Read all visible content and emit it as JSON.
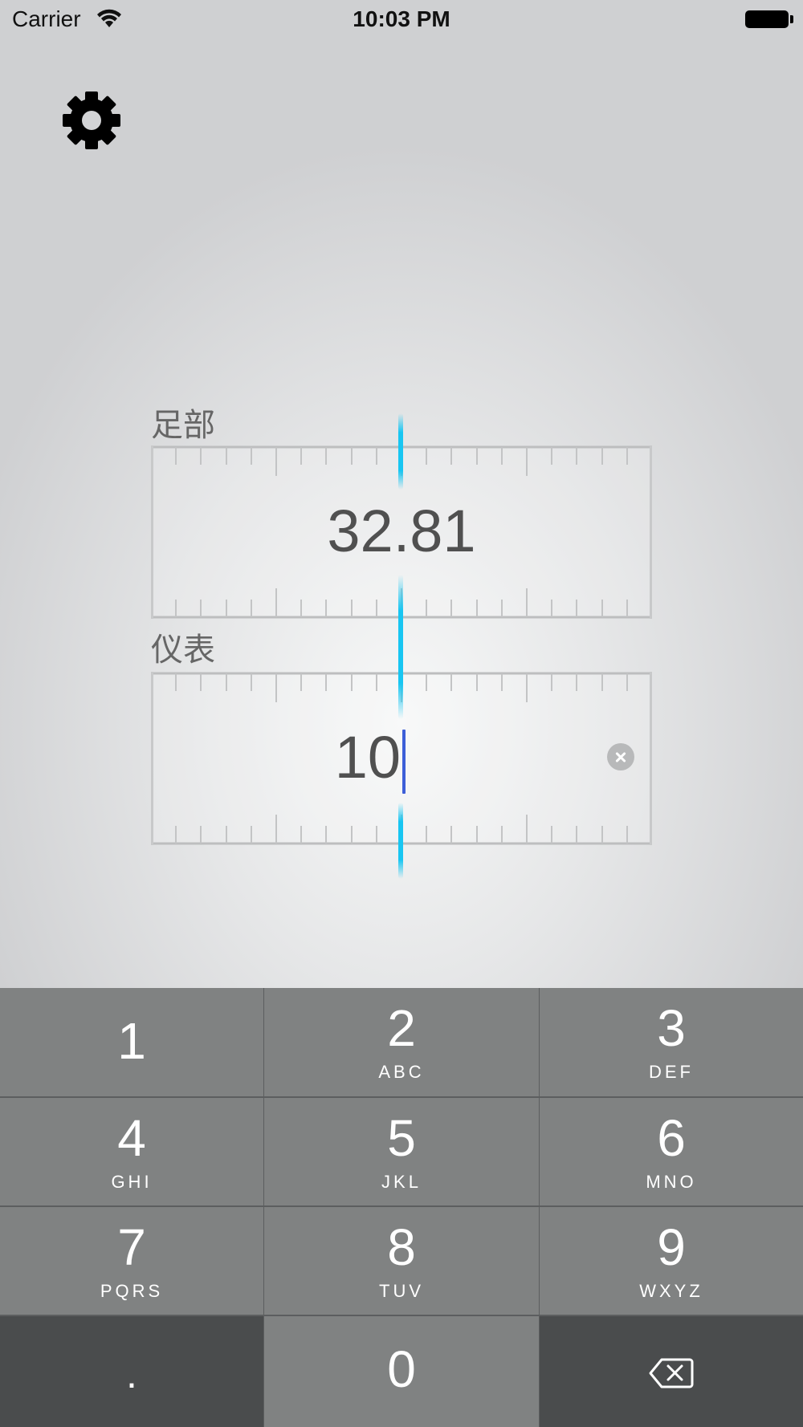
{
  "status_bar": {
    "carrier": "Carrier",
    "time": "10:03 PM"
  },
  "fields": {
    "feet": {
      "label": "足部",
      "value": "32.81"
    },
    "meters": {
      "label": "仪表",
      "value": "10"
    }
  },
  "keypad": {
    "keys": [
      {
        "digit": "1",
        "letters": ""
      },
      {
        "digit": "2",
        "letters": "ABC"
      },
      {
        "digit": "3",
        "letters": "DEF"
      },
      {
        "digit": "4",
        "letters": "GHI"
      },
      {
        "digit": "5",
        "letters": "JKL"
      },
      {
        "digit": "6",
        "letters": "MNO"
      },
      {
        "digit": "7",
        "letters": "PQRS"
      },
      {
        "digit": "8",
        "letters": "TUV"
      },
      {
        "digit": "9",
        "letters": "WXYZ"
      }
    ],
    "decimal": ".",
    "zero": "0"
  },
  "icons": {
    "settings": "gear-icon",
    "backspace": "backspace-icon",
    "clear": "clear-icon",
    "wifi": "wifi-icon",
    "battery": "battery-icon"
  },
  "colors": {
    "indicator": "#18c6f2",
    "caret": "#3d5fd8",
    "key": "#808282",
    "key_dark": "#4a4c4d"
  }
}
